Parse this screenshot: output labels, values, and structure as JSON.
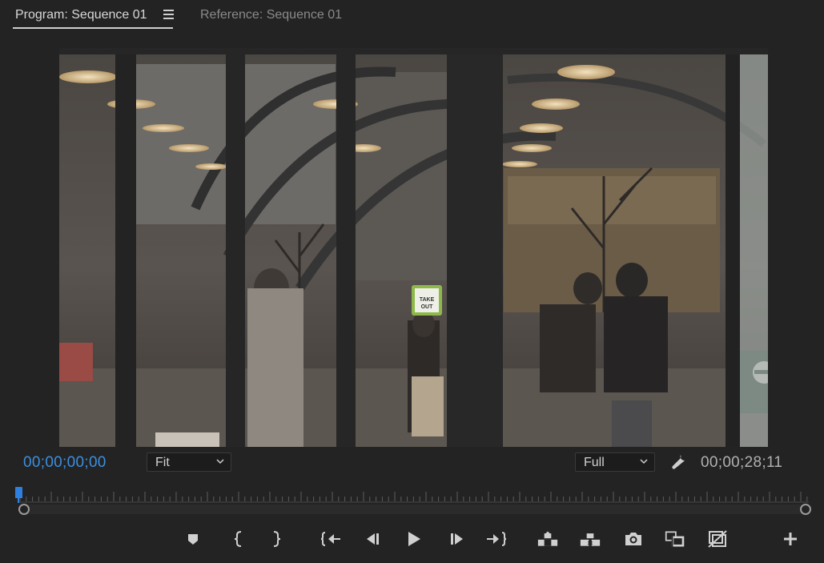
{
  "tabs": [
    {
      "label": "Program: Sequence 01",
      "active": true
    },
    {
      "label": "Reference: Sequence 01",
      "active": false
    }
  ],
  "monitor": {
    "current_timecode": "00;00;00;00",
    "duration_timecode": "00;00;28;11",
    "zoom_select": {
      "value": "Fit"
    },
    "resolution_select": {
      "value": "Full"
    },
    "frame_signage": {
      "sign_line1": "TAKE",
      "sign_line2": "OUT"
    }
  },
  "transport": {
    "buttons": [
      {
        "name": "add-marker-button",
        "icon": "marker-icon"
      },
      {
        "name": "mark-in-button",
        "icon": "mark-in-icon"
      },
      {
        "name": "mark-out-button",
        "icon": "mark-out-icon"
      },
      {
        "name": "go-to-in-button",
        "icon": "go-to-in-icon"
      },
      {
        "name": "step-back-button",
        "icon": "step-back-icon"
      },
      {
        "name": "play-button",
        "icon": "play-icon"
      },
      {
        "name": "step-forward-button",
        "icon": "step-forward-icon"
      },
      {
        "name": "go-to-out-button",
        "icon": "go-to-out-icon"
      },
      {
        "name": "lift-button",
        "icon": "lift-icon"
      },
      {
        "name": "extract-button",
        "icon": "extract-icon"
      },
      {
        "name": "export-frame-button",
        "icon": "camera-icon"
      },
      {
        "name": "comparison-view-button",
        "icon": "comparison-view-icon"
      },
      {
        "name": "proxy-toggle-button",
        "icon": "proxy-icon"
      },
      {
        "name": "button-editor-button",
        "icon": "plus-icon"
      }
    ]
  },
  "colors": {
    "background": "#232323",
    "timecode_accent": "#3c8fe0",
    "playhead": "#2f7fe0"
  }
}
